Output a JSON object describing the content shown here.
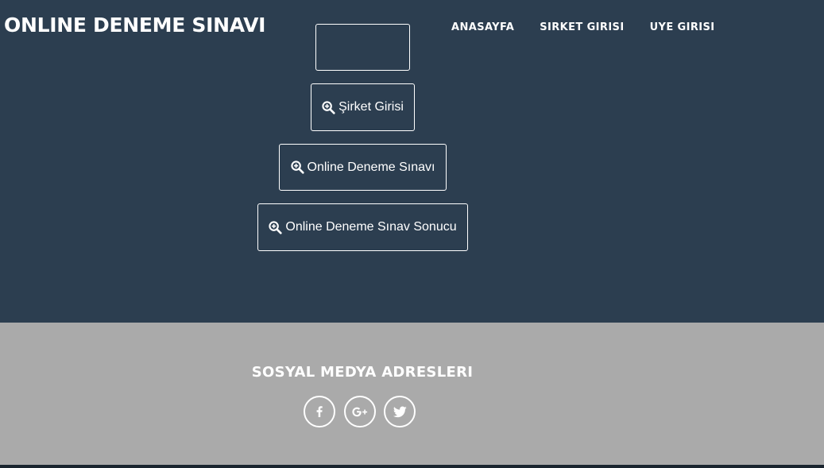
{
  "navbar": {
    "brand": "ONLINE DENEME SINAVI",
    "links": [
      "ANASAYFA",
      "SIRKET GIRISI",
      "UYE GIRISI"
    ]
  },
  "hero": {
    "buttons": [
      "",
      "Şirket Girisi",
      "Online Deneme Sınavı",
      "Online Deneme Sınav Sonucu"
    ]
  },
  "footer": {
    "title": "SOSYAL MEDYA ADRESLERI",
    "social_icons": [
      "facebook-icon",
      "google-plus-icon",
      "twitter-icon"
    ]
  },
  "colors": {
    "header_bg": "#2c3e50",
    "footer_bg": "#aaaaaa",
    "text": "#ffffff"
  }
}
